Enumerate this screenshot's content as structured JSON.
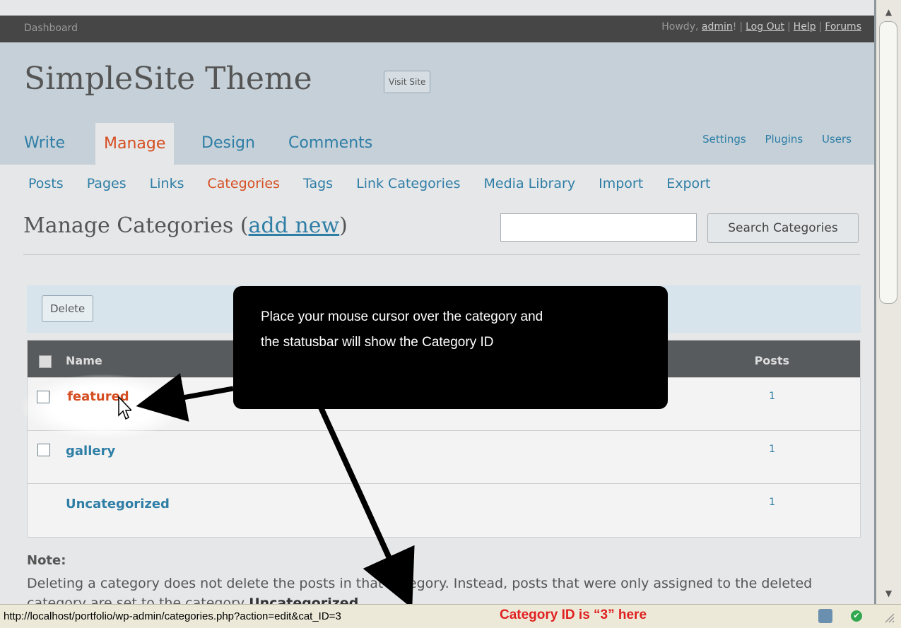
{
  "topbar": {
    "dashboard": "Dashboard",
    "howdy": "Howdy,",
    "user": "admin",
    "user_suffix": "!",
    "logout": "Log Out",
    "help": "Help",
    "forums": "Forums"
  },
  "header": {
    "site_title": "SimpleSite Theme",
    "visit_site": "Visit Site",
    "tabs": [
      "Write",
      "Manage",
      "Design",
      "Comments"
    ],
    "secondary": [
      "Settings",
      "Plugins",
      "Users"
    ]
  },
  "submenu": [
    "Posts",
    "Pages",
    "Links",
    "Categories",
    "Tags",
    "Link Categories",
    "Media Library",
    "Import",
    "Export"
  ],
  "page": {
    "heading": "Manage Categories (",
    "add_new": "add new",
    "heading_close": ")",
    "search_button": "Search Categories",
    "search_value": ""
  },
  "bulk": {
    "delete": "Delete"
  },
  "table": {
    "col_name": "Name",
    "col_posts": "Posts",
    "rows": [
      {
        "name": "featured",
        "posts": "1"
      },
      {
        "name": "gallery",
        "posts": "1"
      },
      {
        "name": "Uncategorized",
        "posts": "1"
      }
    ]
  },
  "note": {
    "label": "Note:",
    "text_a": "Deleting a category does not delete the posts in that category. Instead, posts that were only assigned to the deleted category are set to the category",
    "text_b": "Uncategorized"
  },
  "callout": {
    "line1": "Place your mouse cursor over the category and",
    "line2": "the statusbar will show the Category ID"
  },
  "statusbar": {
    "url": "http://localhost/portfolio/wp-admin/categories.php?action=edit&cat_ID=3",
    "annotation": "Category ID is “3” here"
  },
  "colors": {
    "link": "#2e7ea6",
    "active": "#d54e21",
    "annotation_red": "#e02020"
  }
}
